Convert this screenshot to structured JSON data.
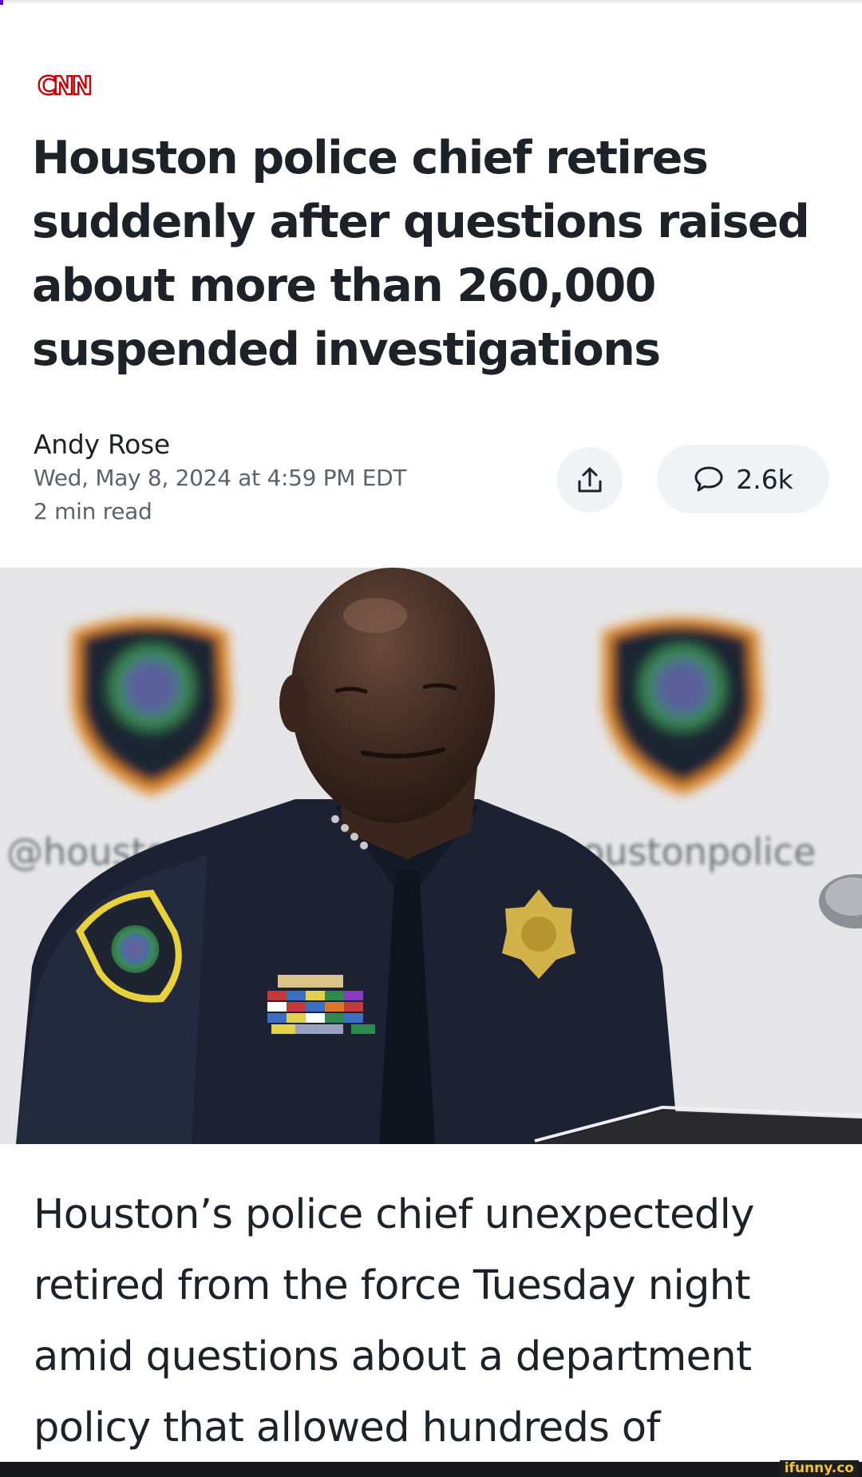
{
  "publisher": {
    "logo_text": "CNN",
    "brand_color": "#cc0000"
  },
  "article": {
    "headline": "Houston police chief retires suddenly after questions raised about more than 260,000 suspended investigations",
    "author": "Andy Rose",
    "published": "Wed, May 8, 2024 at 4:59 PM EDT",
    "read_time": "2 min read",
    "body_excerpt": "Houston’s police chief unexpectedly retired from the force Tuesday night amid questions about a department policy that allowed hundreds of"
  },
  "actions": {
    "share_icon": "share-upload-icon",
    "comment_icon": "speech-bubble-icon",
    "comment_count": "2.6k"
  },
  "hero_image": {
    "backdrop_text_left": "@houston",
    "backdrop_text_right": "houstonpolice"
  },
  "watermark": {
    "text": "ifunny.co",
    "color": "#f2c52a"
  }
}
